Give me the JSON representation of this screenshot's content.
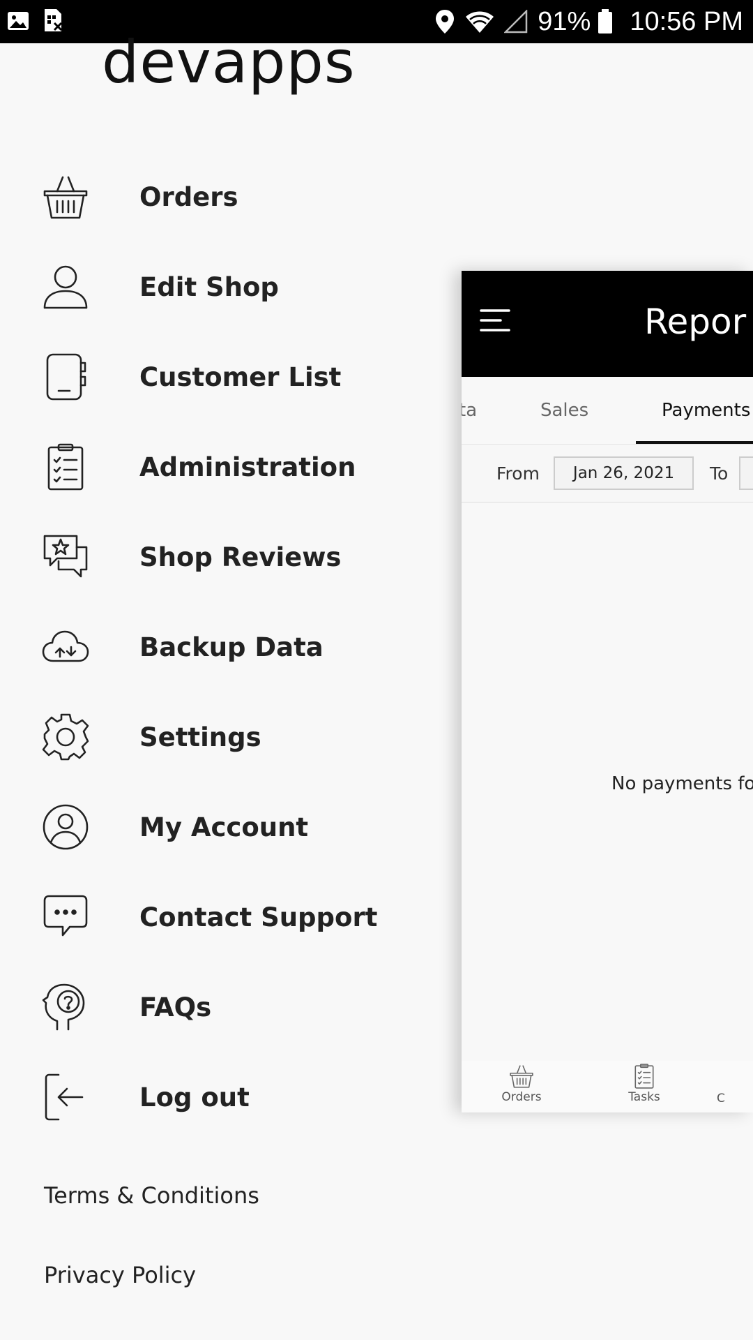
{
  "status_bar": {
    "icons_left": [
      "image-icon",
      "sim-card-icon"
    ],
    "icons_right": [
      "location-icon",
      "wifi-icon",
      "cell-signal-icon",
      "battery-icon"
    ],
    "battery_percent": "91%",
    "time": "10:56 PM"
  },
  "drawer": {
    "brand": "devapps",
    "menu": [
      {
        "label": "Orders",
        "icon": "basket-icon"
      },
      {
        "label": "Edit Shop",
        "icon": "person-icon"
      },
      {
        "label": "Customer List",
        "icon": "address-book-icon"
      },
      {
        "label": "Administration",
        "icon": "clipboard-checklist-icon"
      },
      {
        "label": "Shop Reviews",
        "icon": "review-chat-star-icon"
      },
      {
        "label": "Backup Data",
        "icon": "cloud-sync-icon"
      },
      {
        "label": "Settings",
        "icon": "gear-icon"
      },
      {
        "label": "My Account",
        "icon": "account-circle-icon"
      },
      {
        "label": "Contact Support",
        "icon": "chat-bubble-icon"
      },
      {
        "label": "FAQs",
        "icon": "head-question-icon"
      },
      {
        "label": "Log out",
        "icon": "logout-icon"
      }
    ],
    "footer": {
      "terms": "Terms & Conditions",
      "privacy": "Privacy Policy"
    }
  },
  "preview": {
    "title": "Repor",
    "tabs": [
      {
        "label": "ta",
        "active": false
      },
      {
        "label": "Sales",
        "active": false
      },
      {
        "label": "Payments",
        "active": true
      }
    ],
    "filter": {
      "from_label": "From",
      "from_value": "Jan 26, 2021",
      "to_label": "To",
      "to_value": ""
    },
    "empty_message": "No payments fo",
    "bottom_nav": [
      {
        "label": "Orders",
        "icon": "basket-icon"
      },
      {
        "label": "Tasks",
        "icon": "clipboard-checklist-icon"
      },
      {
        "label": "C",
        "icon": ""
      }
    ]
  }
}
